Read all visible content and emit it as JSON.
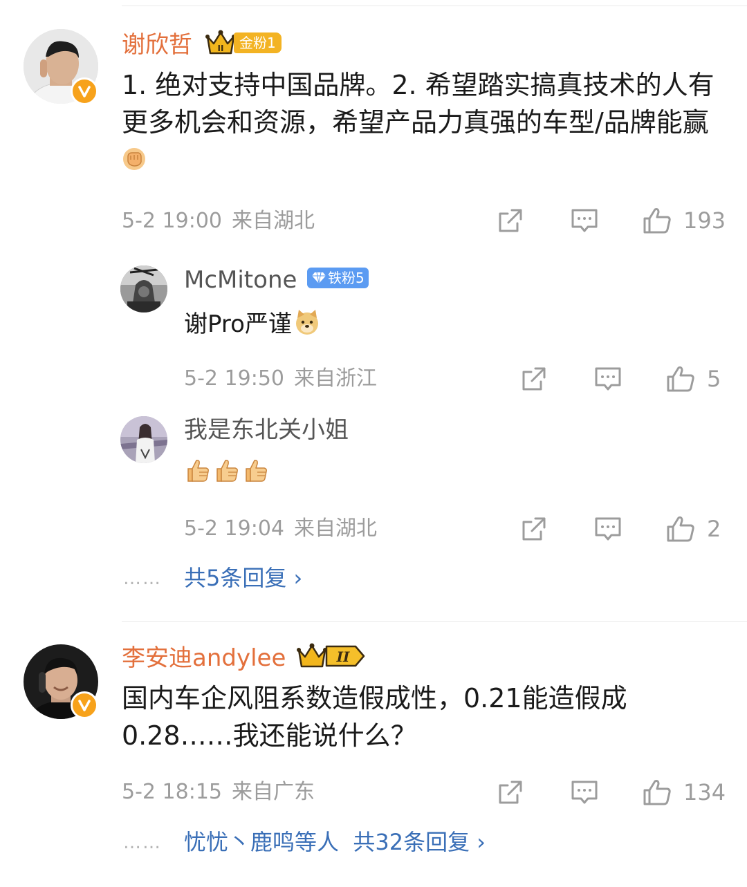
{
  "comments": [
    {
      "username": "谢欣哲",
      "fan_badge": "金粉1",
      "text": "1. 绝对支持中国品牌。2. 希望踏实搞真技术的人有更多机会和资源，希望产品力真强的车型/品牌能赢",
      "time": "5-2 19:00",
      "location": "来自湖北",
      "likes": "193",
      "replies": [
        {
          "username": "McMitone",
          "fan_badge": "铁粉5",
          "text": "谢Pro严谨",
          "time": "5-2 19:50",
          "location": "来自浙江",
          "likes": "5"
        },
        {
          "username": "我是东北关小姐",
          "text": "",
          "time": "5-2 19:04",
          "location": "来自湖北",
          "likes": "2"
        }
      ],
      "more_replies": "共5条回复 ›"
    },
    {
      "username": "李安迪andylee",
      "text": "国内车企风阻系数造假成性，0.21能造假成0.28……我还能说什么？",
      "time": "5-2 18:15",
      "location": "来自广东",
      "likes": "134",
      "more_replies": "忧忧丶鹿鸣等人  共32条回复 ›"
    }
  ],
  "dots": "……",
  "icons": [
    "share-icon",
    "comment-icon",
    "like-icon",
    "verified-v-icon",
    "crown-icon",
    "diamond-icon",
    "fist-emoji",
    "doge-emoji",
    "thumbs-up-emoji"
  ],
  "colors": {
    "username": "#e3703c",
    "link": "#3a6fb7",
    "meta": "#9c9c9c",
    "verified": "#f7a21b",
    "iron_badge": "#5b9bf2",
    "gold_badge": "#f3b323"
  }
}
